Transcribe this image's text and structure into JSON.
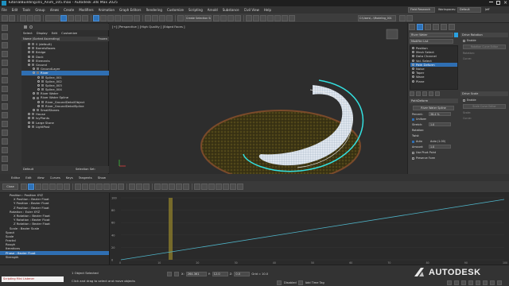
{
  "window": {
    "title": "TutorialBuilding101_Anim_105.max - Autodesk 3ds Max 2025",
    "search_placeholder": "Field Research",
    "workspace_label": "Workspaces:",
    "workspace_value": "Default",
    "login": "Jeff"
  },
  "menu": [
    "File",
    "Edit",
    "Tools",
    "Group",
    "Views",
    "Create",
    "Modifiers",
    "Animation",
    "Graph Editors",
    "Rendering",
    "Customize",
    "Scripting",
    "Arnold",
    "Substance",
    "Civil View",
    "Help"
  ],
  "toolbar": {
    "selection_set": "Create Selection Se",
    "path": "C:\\Users\\...\\Modeling_001"
  },
  "scene": {
    "tabs": [
      "Select",
      "Display",
      "Edit",
      "Customize"
    ],
    "header": "Name (Sorted Ascending)",
    "frozen_header": "Frozen",
    "items": [
      {
        "label": "0 (default)",
        "indent": 1,
        "selected": false
      },
      {
        "label": "BarrelsBoxes",
        "indent": 1,
        "selected": false
      },
      {
        "label": "Bridge",
        "indent": 1,
        "selected": false
      },
      {
        "label": "Dock",
        "indent": 1,
        "selected": false
      },
      {
        "label": "Elements",
        "indent": 1,
        "selected": false
      },
      {
        "label": "Ground",
        "indent": 1,
        "selected": false
      },
      {
        "label": "GroundLayer",
        "indent": 2,
        "selected": false
      },
      {
        "label": "River",
        "indent": 2,
        "selected": true
      },
      {
        "label": "Spline_001",
        "indent": 3,
        "selected": false
      },
      {
        "label": "Spline_002",
        "indent": 3,
        "selected": false
      },
      {
        "label": "Spline_003",
        "indent": 3,
        "selected": false
      },
      {
        "label": "Spline_004",
        "indent": 3,
        "selected": false
      },
      {
        "label": "River Water",
        "indent": 2,
        "selected": false
      },
      {
        "label": "River Water Spline",
        "indent": 2,
        "selected": false
      },
      {
        "label": "River_GroundDetailObject",
        "indent": 3,
        "selected": false
      },
      {
        "label": "River_GroundDetailSpline",
        "indent": 3,
        "selected": false
      },
      {
        "label": "SmallStones",
        "indent": 2,
        "selected": false
      },
      {
        "label": "House",
        "indent": 1,
        "selected": false
      },
      {
        "label": "IvyPlants",
        "indent": 1,
        "selected": false
      },
      {
        "label": "Large Stone",
        "indent": 1,
        "selected": false
      },
      {
        "label": "LightPost",
        "indent": 1,
        "selected": false
      }
    ],
    "footer_layer": "Default",
    "footer_selset": "Selection Set:"
  },
  "viewport": {
    "label": "[+] [Perspective ] [High Quality ] [Edged Faces ]"
  },
  "cmd": {
    "object_name": "River Water",
    "modifier_list": "Modifier List",
    "stack": [
      {
        "label": "Position",
        "selected": false
      },
      {
        "label": "Mesh Select",
        "selected": false
      },
      {
        "label": "Data Channel",
        "selected": false
      },
      {
        "label": "Vol. Select",
        "selected": false
      },
      {
        "label": "Path Deform",
        "selected": true
      },
      {
        "label": "Noise",
        "selected": false
      },
      {
        "label": "Taper",
        "selected": false
      },
      {
        "label": "Wave",
        "selected": false
      },
      {
        "label": "Plane",
        "selected": false
      }
    ],
    "pathdeform_title": "PathDeform",
    "pick_path": "River Water Spline",
    "percent_label": "Percent:",
    "percent_value": "38.4 %",
    "uniform_label": "Uniform",
    "stretch_label": "Stretch:",
    "stretch_value": "1.0",
    "rotation_label": "Rotation:",
    "twist_label": "Twist:",
    "auto_label": "Auto",
    "auto_value": "Auto (1.00)",
    "amount_label": "Amount:",
    "amount_value": "1.0",
    "use_pivot": "Use Pivot Point",
    "preserve_form": "Preserve Form",
    "drive_rotation": "Drive Rotation",
    "drive_scale": "Drive Scale",
    "enable": "Enable",
    "rotation_curve_editor": "Rotation Curve Editor",
    "scale_curve_editor": "Scale Curve Editor",
    "scale_label": "Scale:",
    "curve_label": "Curve:"
  },
  "curve_editor": {
    "menus": [
      "Editor",
      "Edit",
      "View",
      "Curves",
      "Keys",
      "Tangents",
      "Show"
    ],
    "close_label": "Close",
    "frame_value": "1",
    "value_field": "",
    "tracks": [
      {
        "label": "Position : Position XYZ",
        "indent": 2,
        "selected": false
      },
      {
        "label": "X Position : Bezier Float",
        "indent": 3,
        "selected": false
      },
      {
        "label": "Y Position : Bezier Float",
        "indent": 3,
        "selected": false
      },
      {
        "label": "Z Position : Bezier Float",
        "indent": 3,
        "selected": false
      },
      {
        "label": "Rotation : Euler XYZ",
        "indent": 2,
        "selected": false
      },
      {
        "label": "X Rotation : Bezier Float",
        "indent": 3,
        "selected": false
      },
      {
        "label": "Y Rotation : Bezier Float",
        "indent": 3,
        "selected": false
      },
      {
        "label": "Z Rotation : Bezier Float",
        "indent": 3,
        "selected": false
      },
      {
        "label": "Scale : Bezier Scale",
        "indent": 2,
        "selected": false
      },
      {
        "label": "Spout",
        "indent": 1,
        "selected": false
      },
      {
        "label": "Scale",
        "indent": 1,
        "selected": false
      },
      {
        "label": "Fractal",
        "indent": 1,
        "selected": false
      },
      {
        "label": "Rough",
        "indent": 1,
        "selected": false
      },
      {
        "label": "Iterations",
        "indent": 1,
        "selected": false
      },
      {
        "label": "Phase : Bezier Float",
        "indent": 1,
        "selected": true
      },
      {
        "label": "Strength",
        "indent": 1,
        "selected": false
      }
    ],
    "y_ticks": [
      "100",
      "80",
      "60",
      "40",
      "20",
      "0"
    ],
    "x_ticks": [
      "0",
      "10",
      "20",
      "30",
      "40",
      "50",
      "60",
      "70",
      "80",
      "90",
      "100"
    ],
    "frame_field": "0",
    "frame_field2": "0"
  },
  "status": {
    "listener": "Scripting Mini Listener",
    "objects_selected": "1 Object Selected",
    "prompt": "Click and drag to select and move objects",
    "x_label": "X:",
    "x_value": "264.361",
    "y_label": "Y:",
    "y_value": "12.0",
    "z_label": "Z:",
    "z_value": "0.0",
    "grid_label": "Grid = 10.0",
    "disabled_label": "Disabled",
    "add_time_tag": "Add Time Tag",
    "autodesk": "AUTODESK"
  }
}
